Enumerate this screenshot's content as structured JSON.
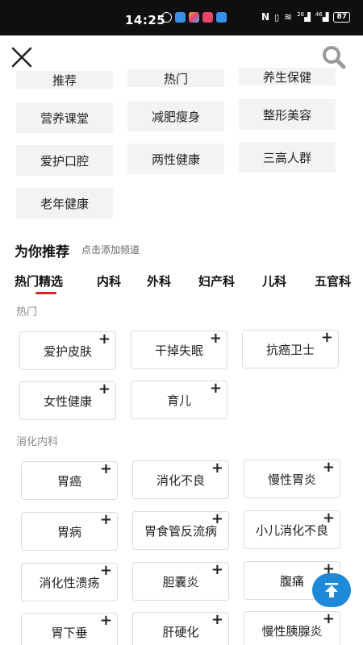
{
  "status": {
    "time": "14:25",
    "battery": "87",
    "network_a": "26",
    "network_b": "46"
  },
  "header": {
    "close_icon": "close-icon",
    "search_icon": "search-icon"
  },
  "channels_top": [
    "推荐",
    "热门",
    "养生保健"
  ],
  "channels": [
    [
      "营养课堂",
      "减肥瘦身",
      "整形美容"
    ],
    [
      "爱护口腔",
      "两性健康",
      "三高人群"
    ],
    [
      "老年健康"
    ]
  ],
  "recommend": {
    "title": "为你推荐",
    "hint": "点击添加频道"
  },
  "tabs": [
    "热门精选",
    "内科",
    "外科",
    "妇产科",
    "儿科",
    "五官科"
  ],
  "sections": [
    {
      "label": "热门",
      "items": [
        "爱护皮肤",
        "干掉失眠",
        "抗癌卫士",
        "女性健康",
        "育儿"
      ]
    },
    {
      "label": "消化内科",
      "items": [
        "胃癌",
        "消化不良",
        "慢性胃炎",
        "胃病",
        "胃食管反流病",
        "小儿消化不良",
        "消化性溃疡",
        "胆囊炎",
        "腹痛",
        "胃下垂",
        "肝硬化",
        "慢性胰腺炎"
      ]
    }
  ],
  "add_symbol": "+",
  "fab": {
    "icon": "scroll-to-top-icon"
  },
  "colors": {
    "accent_red": "#d62222",
    "fab_blue": "#1e88d9"
  }
}
